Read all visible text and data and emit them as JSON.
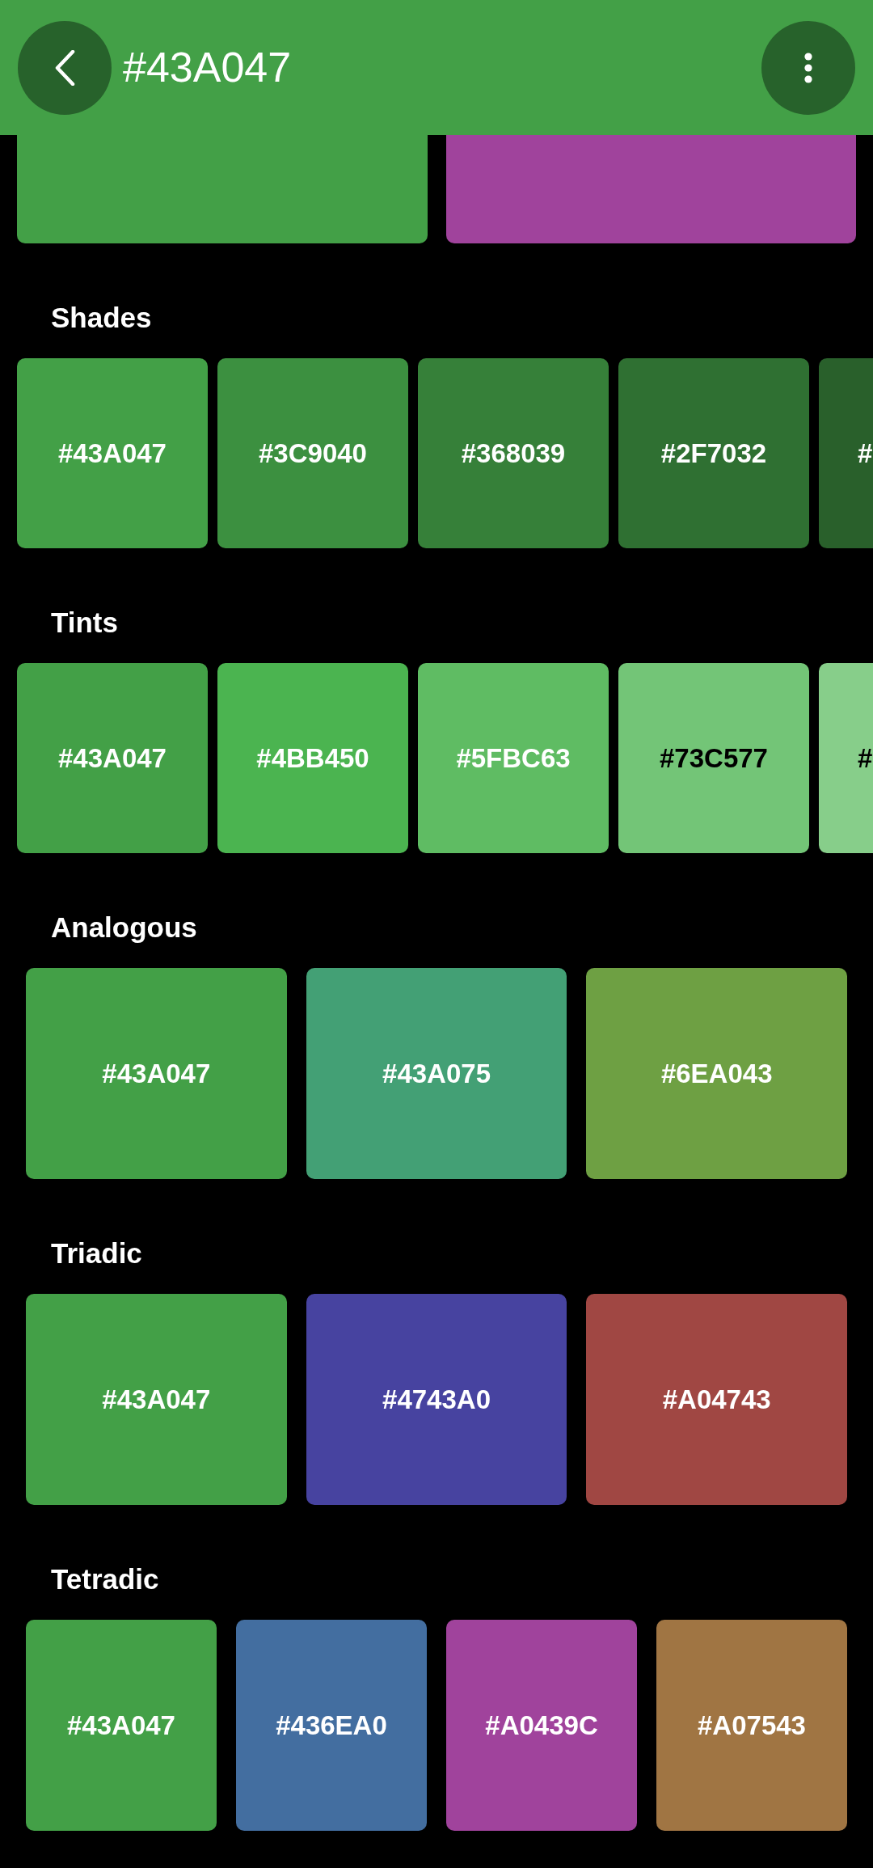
{
  "app_bar": {
    "title": "#43A047"
  },
  "partial_row": {
    "swatches": [
      {
        "color": "#43a047"
      },
      {
        "color": "#a0439c"
      }
    ]
  },
  "sections": [
    {
      "heading": "Shades",
      "kind": "scroll",
      "swatches": [
        {
          "hex": "#43A047",
          "color": "#43a047"
        },
        {
          "hex": "#3C9040",
          "color": "#3c9040"
        },
        {
          "hex": "#368039",
          "color": "#368039"
        },
        {
          "hex": "#2F7032",
          "color": "#2f7032"
        },
        {
          "hex": "#",
          "color": "#29602b"
        }
      ]
    },
    {
      "heading": "Tints",
      "kind": "scroll",
      "swatches": [
        {
          "hex": "#43A047",
          "color": "#43a047"
        },
        {
          "hex": "#4BB450",
          "color": "#4bb450"
        },
        {
          "hex": "#5FBC63",
          "color": "#5fbc63"
        },
        {
          "hex": "#73C577",
          "color": "#73c577"
        },
        {
          "hex": "#",
          "color": "#87ce8a"
        }
      ]
    },
    {
      "heading": "Analogous",
      "kind": "grid",
      "swatches": [
        {
          "hex": "#43A047",
          "color": "#43a047"
        },
        {
          "hex": "#43A075",
          "color": "#43a075"
        },
        {
          "hex": "#6EA043",
          "color": "#6ea043"
        }
      ]
    },
    {
      "heading": "Triadic",
      "kind": "grid",
      "swatches": [
        {
          "hex": "#43A047",
          "color": "#43a047"
        },
        {
          "hex": "#4743A0",
          "color": "#4743a0"
        },
        {
          "hex": "#A04743",
          "color": "#a04743"
        }
      ]
    },
    {
      "heading": "Tetradic",
      "kind": "grid",
      "swatches": [
        {
          "hex": "#43A047",
          "color": "#43a047"
        },
        {
          "hex": "#436EA0",
          "color": "#436ea0"
        },
        {
          "hex": "#A0439C",
          "color": "#a0439c"
        },
        {
          "hex": "#A07543",
          "color": "#a07543"
        }
      ]
    }
  ]
}
